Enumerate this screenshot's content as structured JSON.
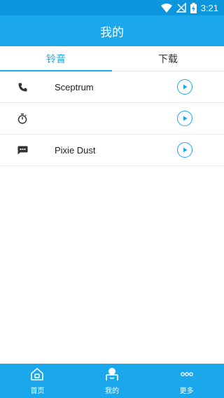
{
  "status_bar": {
    "time": "3:21",
    "icons": [
      "wifi-icon",
      "no-signal-icon",
      "battery-charging-icon"
    ]
  },
  "header": {
    "title": "我的"
  },
  "tabs": [
    {
      "label": "铃音",
      "active": true
    },
    {
      "label": "下载",
      "active": false
    }
  ],
  "rows": [
    {
      "icon": "phone-icon",
      "title": "Sceptrum"
    },
    {
      "icon": "timer-icon",
      "title": ""
    },
    {
      "icon": "message-icon",
      "title": "Pixie Dust"
    }
  ],
  "bottom_nav": [
    {
      "icon": "home-icon",
      "label": "首页"
    },
    {
      "icon": "user-icon",
      "label": "我的"
    },
    {
      "icon": "more-icon",
      "label": "更多"
    }
  ],
  "colors": {
    "primary": "#1aa7ec",
    "status_bar": "#0b96de",
    "text": "#222222"
  }
}
